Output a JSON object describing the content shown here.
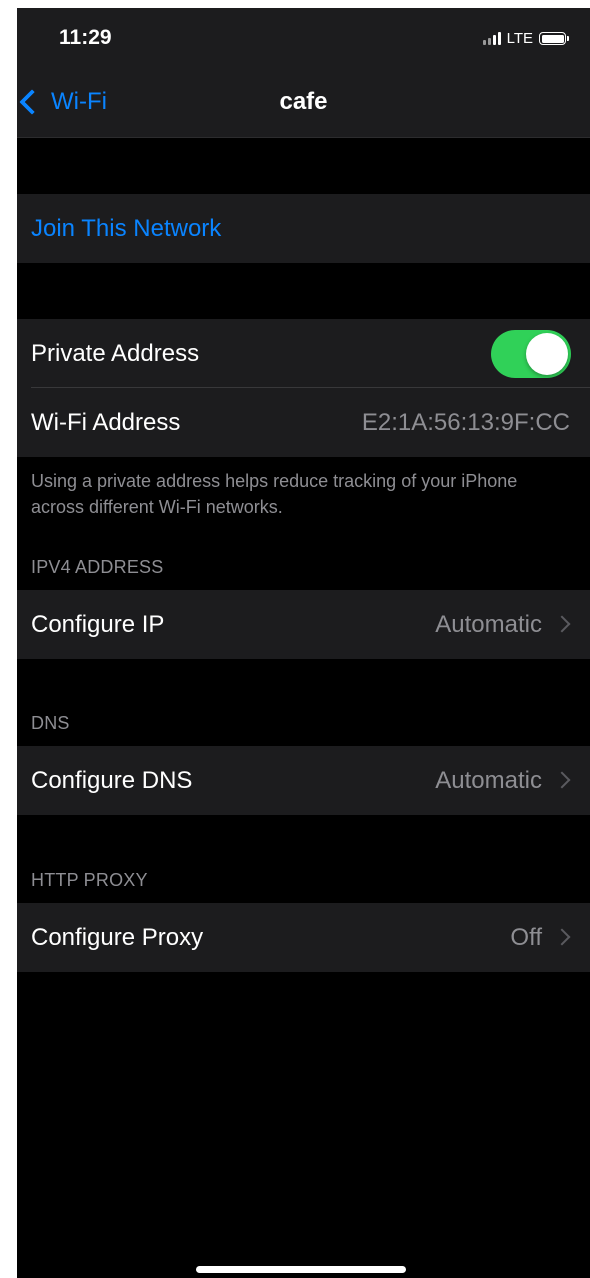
{
  "status_bar": {
    "time": "11:29",
    "network": "LTE"
  },
  "nav": {
    "back_label": "Wi-Fi",
    "title": "cafe"
  },
  "join": {
    "label": "Join This Network"
  },
  "privacy": {
    "private_address_label": "Private Address",
    "private_address_on": true,
    "wifi_address_label": "Wi-Fi Address",
    "wifi_address_value": "E2:1A:56:13:9F:CC",
    "note": "Using a private address helps reduce tracking of your iPhone across different Wi-Fi networks."
  },
  "ipv4": {
    "header": "IPV4 ADDRESS",
    "configure_ip_label": "Configure IP",
    "configure_ip_value": "Automatic"
  },
  "dns": {
    "header": "DNS",
    "configure_dns_label": "Configure DNS",
    "configure_dns_value": "Automatic"
  },
  "proxy": {
    "header": "HTTP PROXY",
    "configure_proxy_label": "Configure Proxy",
    "configure_proxy_value": "Off"
  },
  "colors": {
    "accent": "#0a84ff",
    "toggle_on": "#30d158",
    "background": "#000000",
    "cell": "#1c1c1e",
    "secondary_text": "#8e8e93"
  },
  "icons": {
    "back": "chevron-left-icon",
    "disclosure": "chevron-right-icon",
    "signal": "cellular-signal-icon",
    "battery": "battery-icon"
  }
}
